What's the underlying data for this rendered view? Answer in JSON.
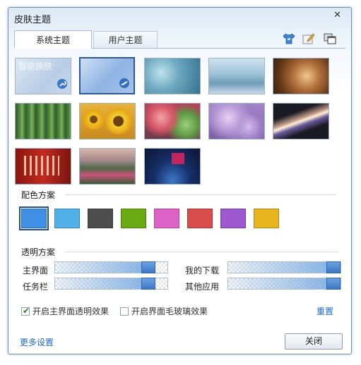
{
  "window": {
    "title": "皮肤主题"
  },
  "tabs": [
    {
      "label": "系统主题"
    },
    {
      "label": "用户主题"
    }
  ],
  "thumbnails": [
    {
      "label": "智能换肤"
    }
  ],
  "color_scheme": {
    "title": "配色方案",
    "colors": [
      "#3f8fe6",
      "#4fb1e8",
      "#4d4d4d",
      "#6aaa12",
      "#df62c6",
      "#d84c4c",
      "#9d57cf",
      "#e7b420"
    ],
    "selected_index": 0
  },
  "transparency": {
    "title": "透明方案",
    "sliders": [
      {
        "label": "主界面",
        "value_percent": 88
      },
      {
        "label": "我的下载",
        "value_percent": 100
      },
      {
        "label": "任务栏",
        "value_percent": 88
      },
      {
        "label": "其他应用",
        "value_percent": 100
      }
    ]
  },
  "options": {
    "main_transparency": {
      "label": "开启主界面透明效果",
      "checked": true
    },
    "frosted_glass": {
      "label": "开启界面毛玻璃效果",
      "checked": false
    },
    "reset_label": "重置"
  },
  "footer": {
    "more_settings": "更多设置",
    "close_label": "关闭"
  },
  "icons": [
    "shirt-icon",
    "edit-icon",
    "windows-icon",
    "close-icon",
    "wrench-icon",
    "bird-icon",
    "checkmark-icon"
  ]
}
